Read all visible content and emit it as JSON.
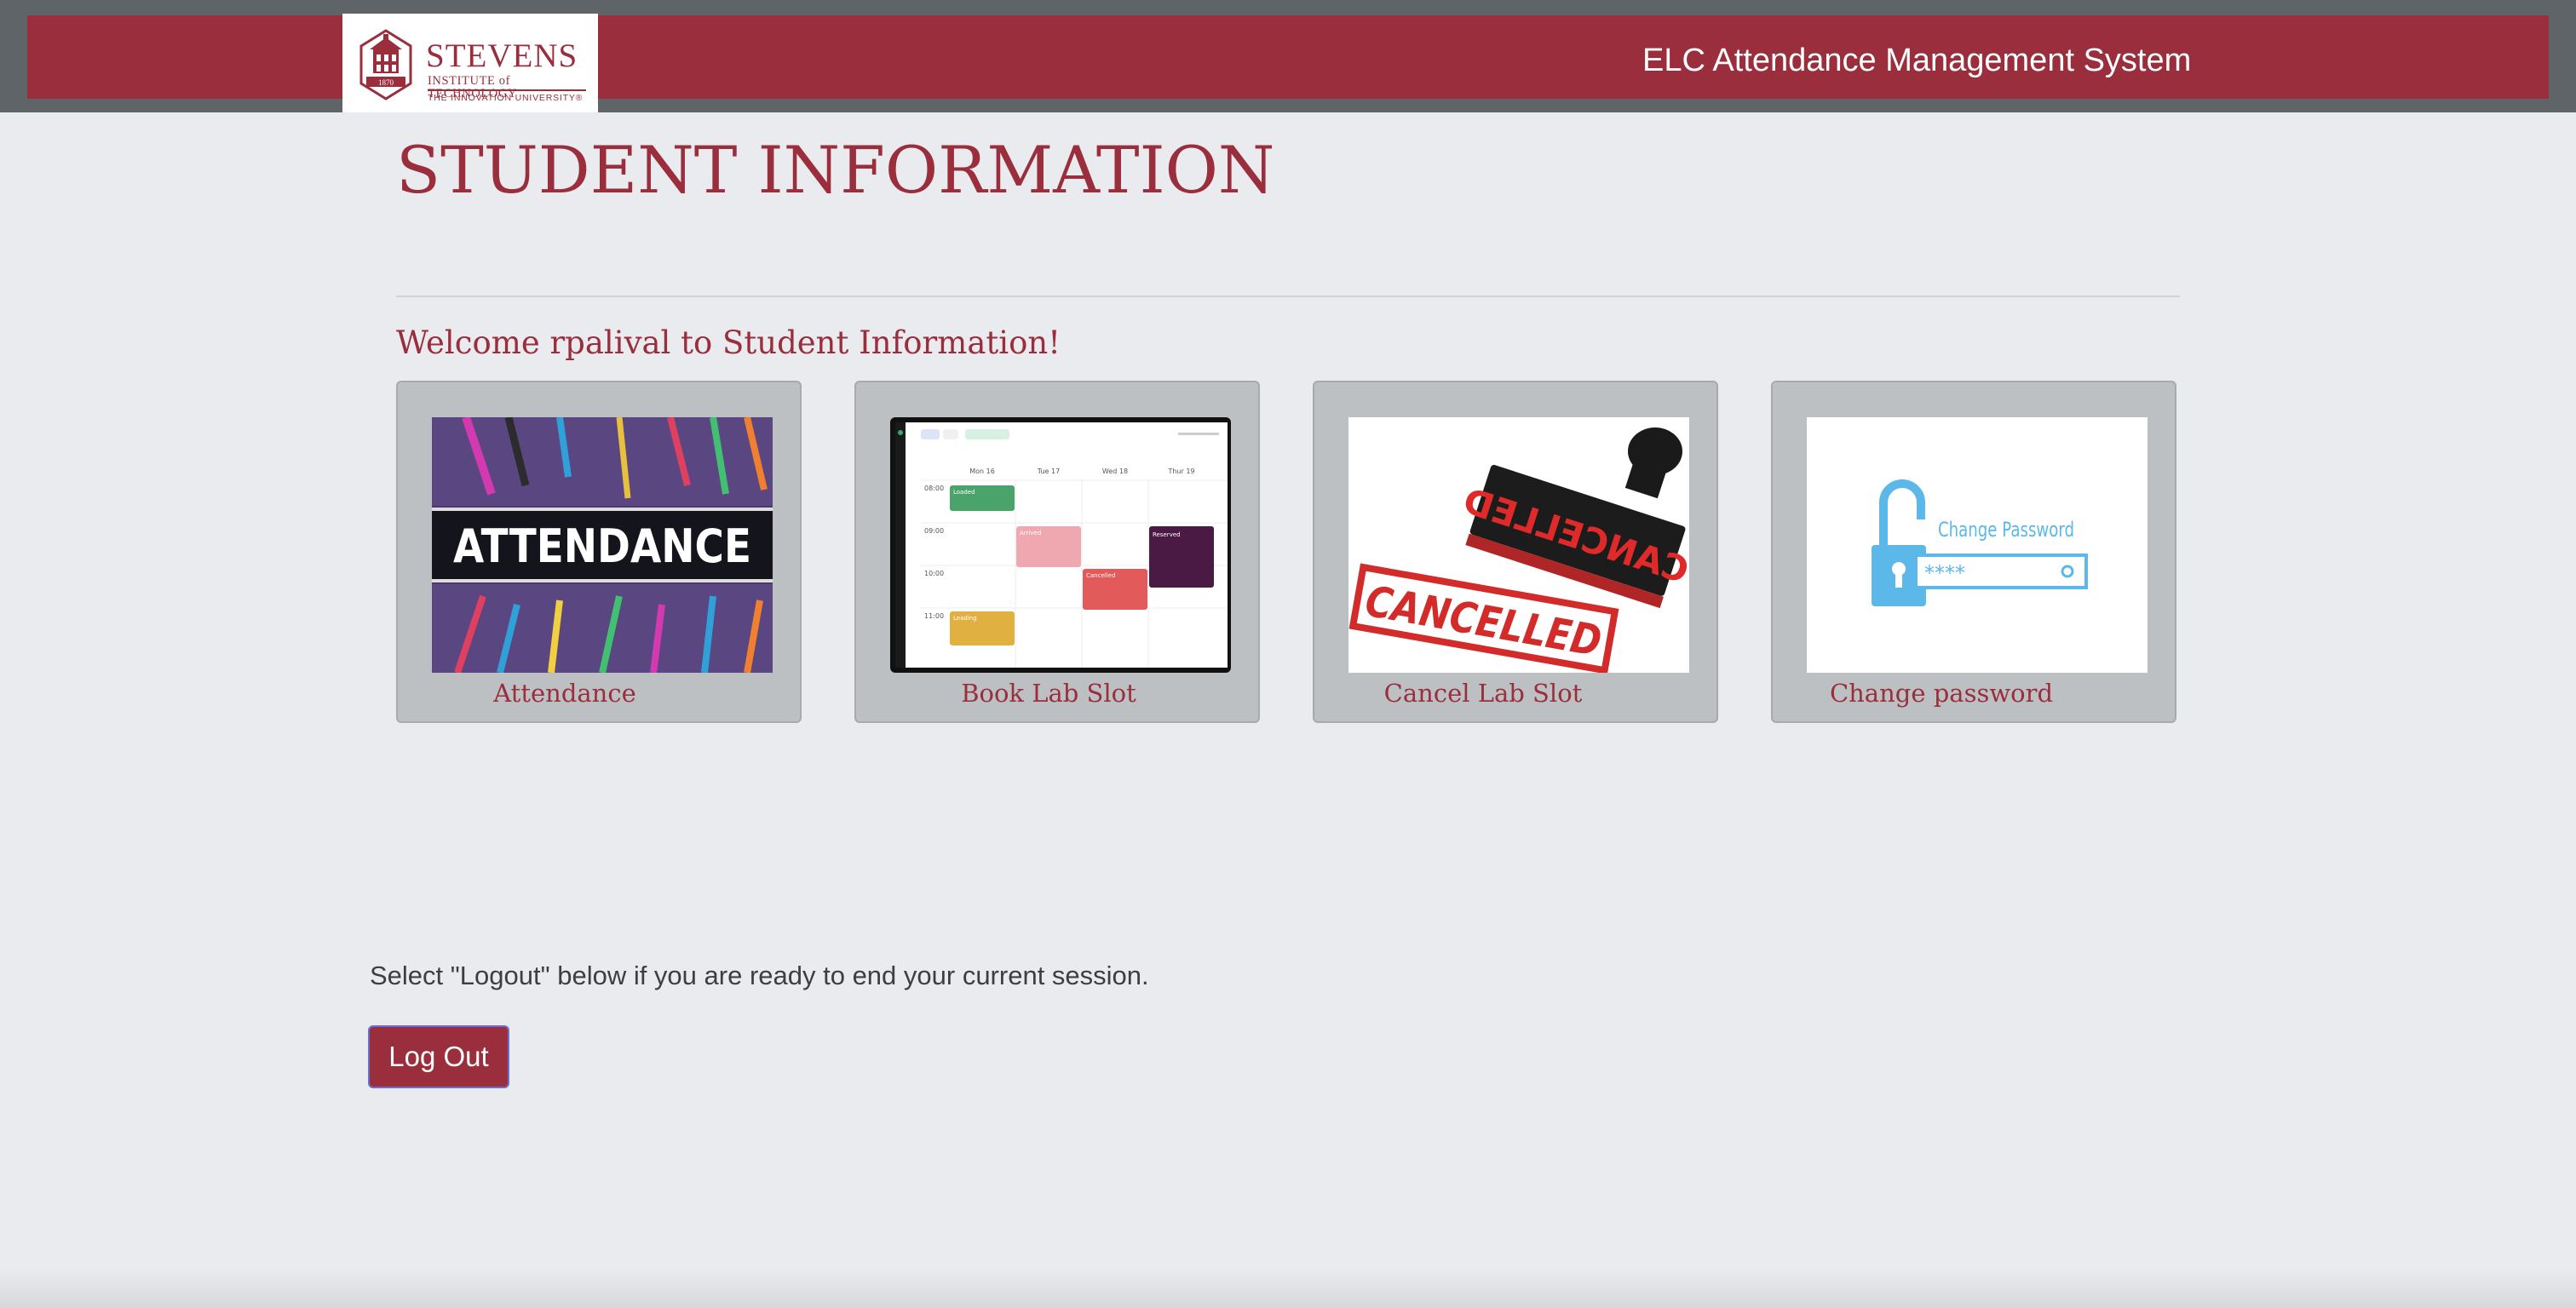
{
  "header": {
    "logo": {
      "name": "STEVENS",
      "subtitle": "INSTITUTE of TECHNOLOGY",
      "tagline": "THE INNOVATION UNIVERSITY®",
      "year": "1870"
    },
    "app_title": "ELC Attendance Management System"
  },
  "main": {
    "page_title": "STUDENT INFORMATION",
    "welcome": "Welcome rpalival to Student Information!",
    "cards": [
      {
        "label": "Attendance",
        "image_text": "ATTENDANCE"
      },
      {
        "label": "Book Lab Slot",
        "calendar": {
          "days": [
            "Mon 16",
            "Tue 17",
            "Wed 18",
            "Thur 19"
          ],
          "times": [
            "08:00",
            "09:00",
            "10:00",
            "11:00"
          ],
          "events": [
            "Loaded",
            "Arrived",
            "Cancelled",
            "Reserved",
            "Leading"
          ]
        }
      },
      {
        "label": "Cancel Lab Slot",
        "image_text": "CANCELLED"
      },
      {
        "label": "Change password",
        "image_text": "Change Password",
        "mask": "****"
      }
    ]
  },
  "footer": {
    "logout_hint": "Select \"Logout\" below if you are ready to end your current session.",
    "logout_label": "Log Out"
  },
  "colors": {
    "brand": "#9a2e3c",
    "header_bg": "#5f6468",
    "page_bg": "#e9ebef",
    "card_bg": "#bcc0c3",
    "button_border": "#6a6fd0"
  }
}
